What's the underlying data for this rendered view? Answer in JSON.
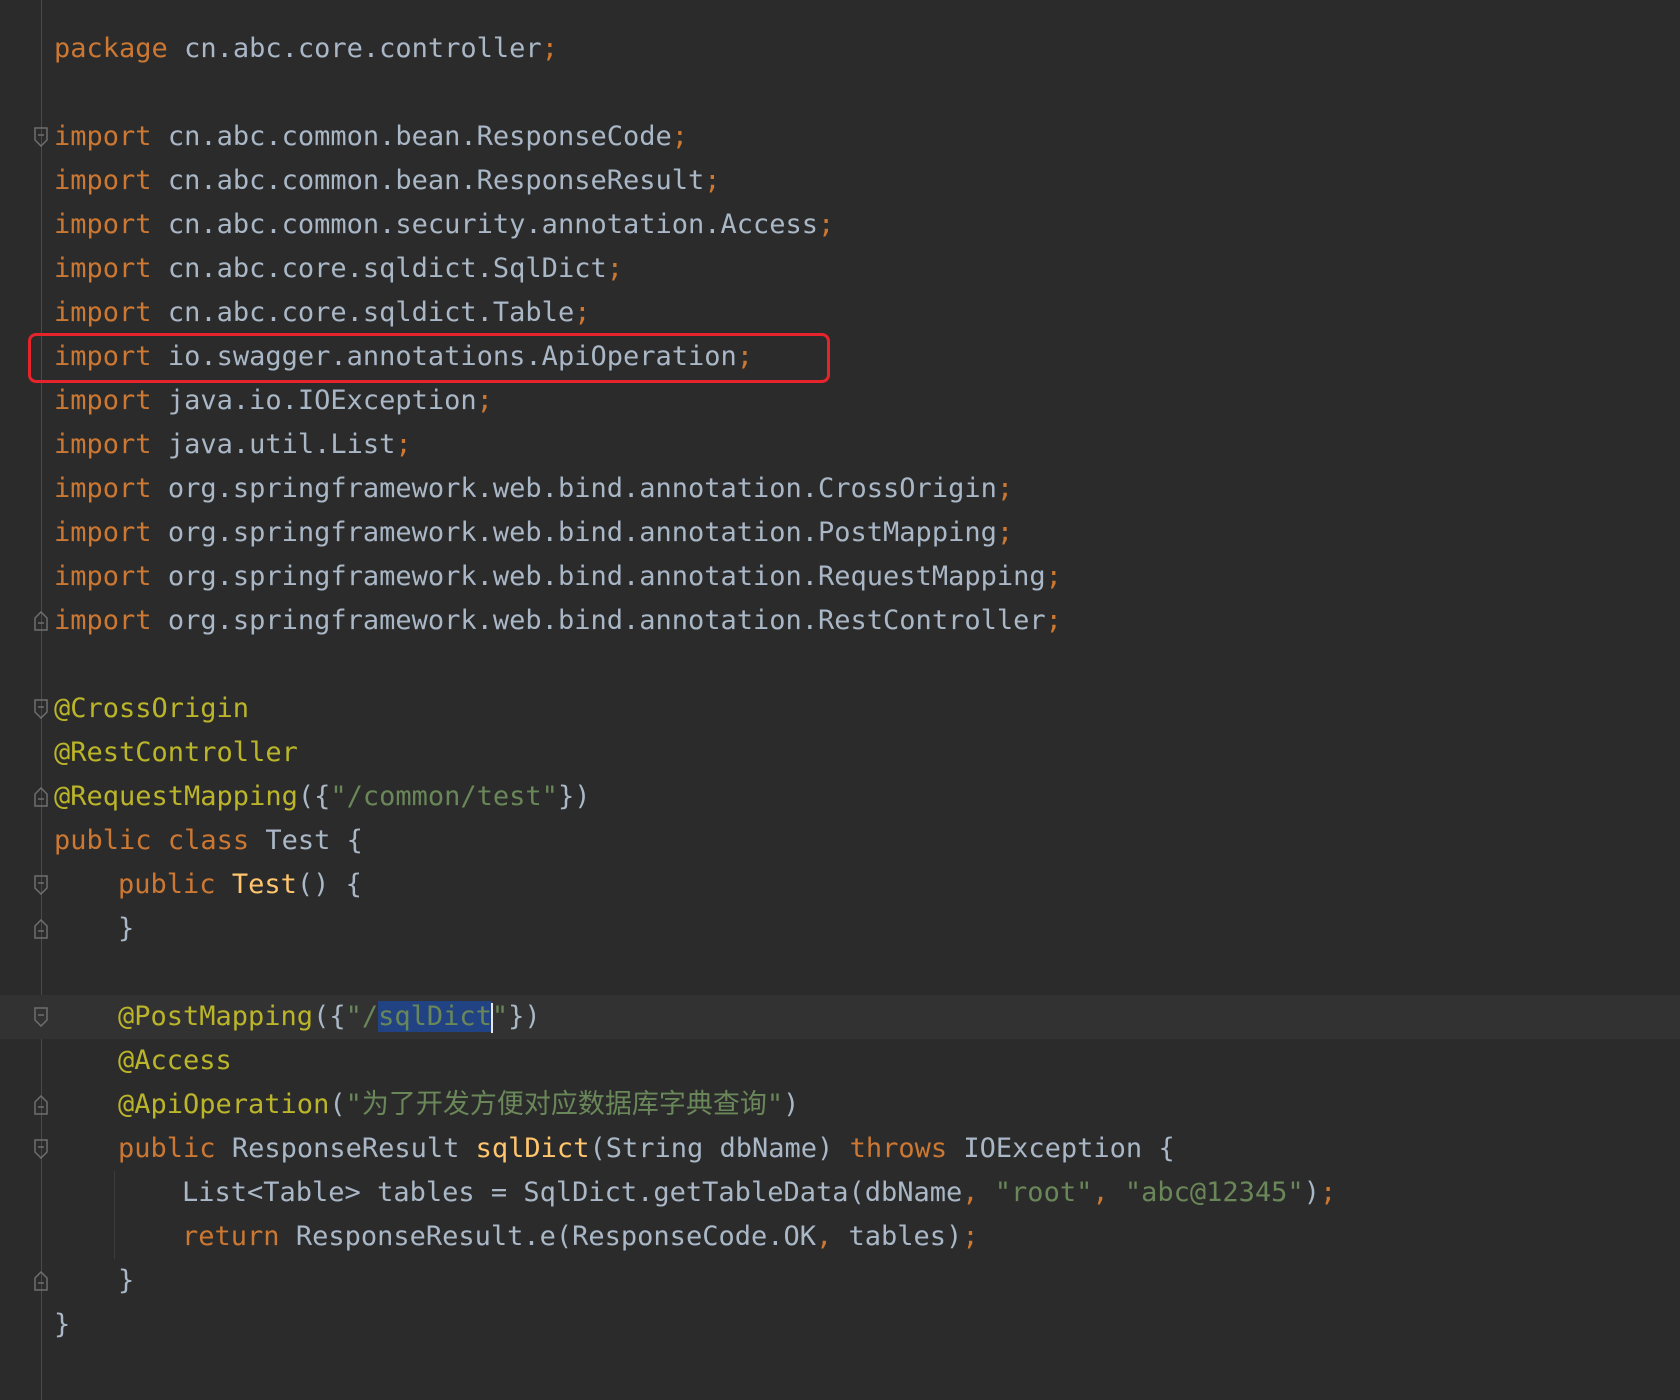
{
  "editor": {
    "theme": "Darcula",
    "colors": {
      "background": "#2b2b2b",
      "keyword": "#cc7832",
      "identifier": "#a9b7c6",
      "annotation": "#bbb529",
      "string": "#6a8759",
      "method": "#ffc66d",
      "selection": "#214283",
      "highlight_box": "#e5242b"
    }
  },
  "code": {
    "package_kw": "package",
    "package_name": "cn.abc.core.controller",
    "semicolon": ";",
    "import_kw": "import",
    "imports": [
      "cn.abc.common.bean.ResponseCode",
      "cn.abc.common.bean.ResponseResult",
      "cn.abc.common.security.annotation.Access",
      "cn.abc.core.sqldict.SqlDict",
      "cn.abc.core.sqldict.Table",
      "io.swagger.annotations.ApiOperation",
      "java.io.IOException",
      "java.util.List",
      "org.springframework.web.bind.annotation.CrossOrigin",
      "org.springframework.web.bind.annotation.PostMapping",
      "org.springframework.web.bind.annotation.RequestMapping",
      "org.springframework.web.bind.annotation.RestController"
    ],
    "anno_cross_origin": "@CrossOrigin",
    "anno_rest_controller": "@RestController",
    "anno_request_mapping": "@RequestMapping",
    "request_mapping_open": "({",
    "request_mapping_value": "\"/common/test\"",
    "request_mapping_close": "})",
    "kw_public": "public",
    "kw_class": "class",
    "class_name": "Test",
    "open_brace": "{",
    "close_brace": "}",
    "ctor_name": "Test",
    "empty_parens": "()",
    "anno_post_mapping": "@PostMapping",
    "post_mapping_open": "({",
    "post_mapping_str_prefix": "\"/",
    "post_mapping_selected": "sqlDict",
    "post_mapping_str_suffix": "\"",
    "post_mapping_close": "})",
    "anno_access": "@Access",
    "anno_api_operation": "@ApiOperation",
    "paren_open": "(",
    "paren_close": ")",
    "api_operation_value": "\"为了开发方便对应数据库字典查询\"",
    "return_type": "ResponseResult",
    "method_name": "sqlDict",
    "method_params": "(String dbName)",
    "kw_throws": "throws",
    "exception_type": "IOException",
    "list_decl": "List<Table> tables = SqlDict.getTableData(dbName",
    "comma": ",",
    "arg_user": "\"root\"",
    "arg_password": "\"abc@12345\"",
    "kw_return": "return",
    "return_expr_1": "ResponseResult.e(ResponseCode.OK",
    "return_expr_2": "tables)"
  }
}
